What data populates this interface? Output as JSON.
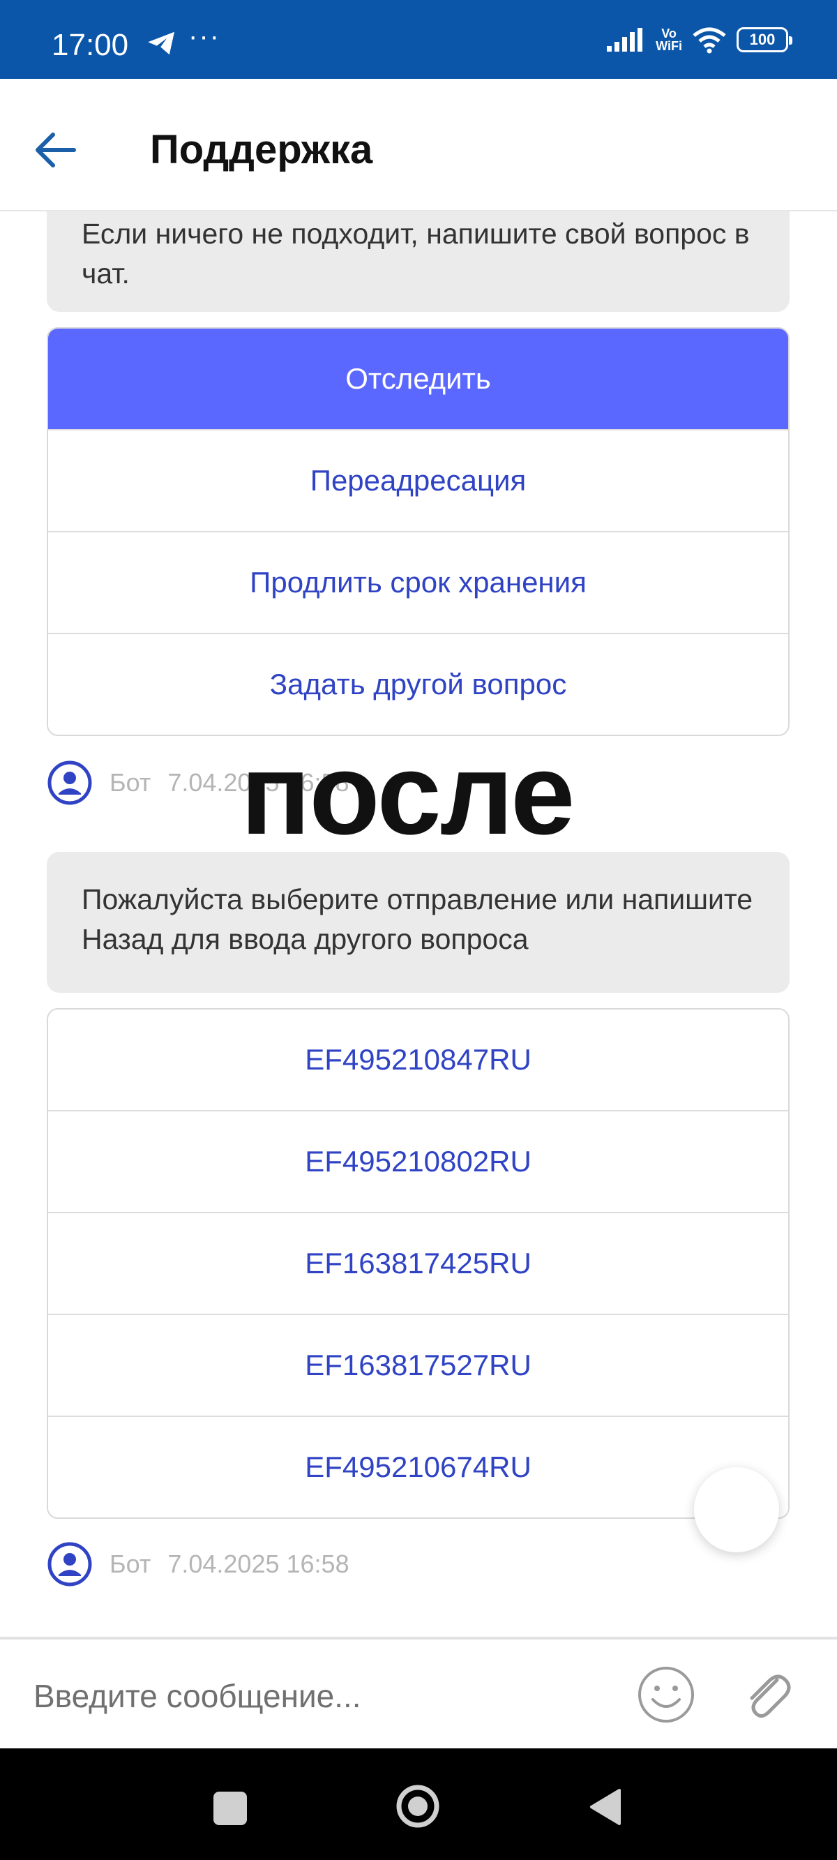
{
  "status_bar": {
    "time": "17:00",
    "dots": "···",
    "vowifi_top": "Vo",
    "vowifi_bottom": "WiFi",
    "battery": "100"
  },
  "app_bar": {
    "title": "Поддержка"
  },
  "messages": [
    {
      "text": "Если ничего не подходит, напишите свой вопрос в чат."
    },
    {
      "text": "Пожалуйста выберите отправление или напишите Назад для ввода другого вопроса"
    }
  ],
  "quick_replies_1": [
    "Отследить",
    "Переадресация",
    "Продлить срок хранения",
    "Задать другой вопрос"
  ],
  "quick_replies_2": [
    "EF495210847RU",
    "EF495210802RU",
    "EF163817425RU",
    "EF163817527RU",
    "EF495210674RU"
  ],
  "meta": [
    {
      "author": "Бот",
      "time": "7.04.2025 16:58"
    },
    {
      "author": "Бот",
      "time": "7.04.2025 16:58"
    }
  ],
  "overlay": {
    "text": "после"
  },
  "composer": {
    "placeholder": "Введите сообщение..."
  },
  "colors": {
    "status_bar": "#0b56a8",
    "active_button": "#5b68ff",
    "link": "#2f43c4",
    "bubble": "#ebebeb"
  }
}
